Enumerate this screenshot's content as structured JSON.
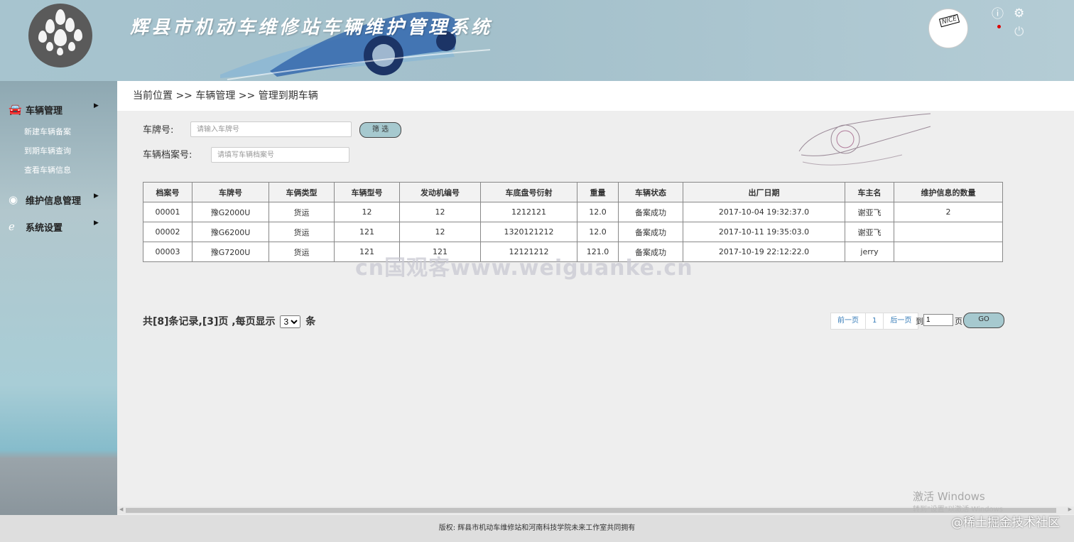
{
  "header": {
    "title": "辉县市机动车维修站车辆维护管理系统",
    "avatar_text": "NICE"
  },
  "sidebar": {
    "menus": [
      {
        "label": "车辆管理",
        "items": [
          "新建车辆备案",
          "到期车辆查询",
          "查看车辆信息"
        ]
      },
      {
        "label": "维护信息管理"
      },
      {
        "label": "系统设置"
      }
    ]
  },
  "breadcrumb": "当前位置 >> 车辆管理 >> 管理到期车辆",
  "filters": {
    "plate_label": "车牌号:",
    "plate_placeholder": "请输入车牌号",
    "filter_button": "筛 选",
    "archive_label": "车辆档案号:",
    "archive_placeholder": "请填写车辆档案号"
  },
  "table": {
    "columns": [
      "档案号",
      "车牌号",
      "车俩类型",
      "车辆型号",
      "发动机编号",
      "车底盘号衍射",
      "重量",
      "车辆状态",
      "出厂日期",
      "车主名",
      "维护信息的数量"
    ],
    "rows": [
      [
        "00001",
        "豫G2000U",
        "货运",
        "12",
        "12",
        "1212121",
        "12.0",
        "备案成功",
        "2017-10-04 19:32:37.0",
        "谢亚飞",
        "2"
      ],
      [
        "00002",
        "豫G6200U",
        "货运",
        "121",
        "12",
        "1320121212",
        "12.0",
        "备案成功",
        "2017-10-11 19:35:03.0",
        "谢亚飞",
        ""
      ],
      [
        "00003",
        "豫G7200U",
        "货运",
        "121",
        "121",
        "12121212",
        "121.0",
        "备案成功",
        "2017-10-19 22:12:22.0",
        "jerry",
        ""
      ]
    ]
  },
  "watermark": "cn国观客www.weiguanke.cn",
  "pagination": {
    "summary_prefix": "共[8]条记录,[3]页 ,每页显示",
    "page_size": "3",
    "summary_suffix": "条",
    "prev": "前一页",
    "current": "1",
    "next": "后一页",
    "goto_label": "到",
    "goto_value": "1",
    "page_unit": "页",
    "go": "GO"
  },
  "os_watermark": {
    "title": "激活 Windows",
    "subtitle": "转到\"设置\"以激活 Windows"
  },
  "footer": {
    "copyright": "版权: 辉县市机动车维修站和河南科技学院未来工作室共同拥有",
    "site_watermark": "@稀土掘金技术社区"
  }
}
